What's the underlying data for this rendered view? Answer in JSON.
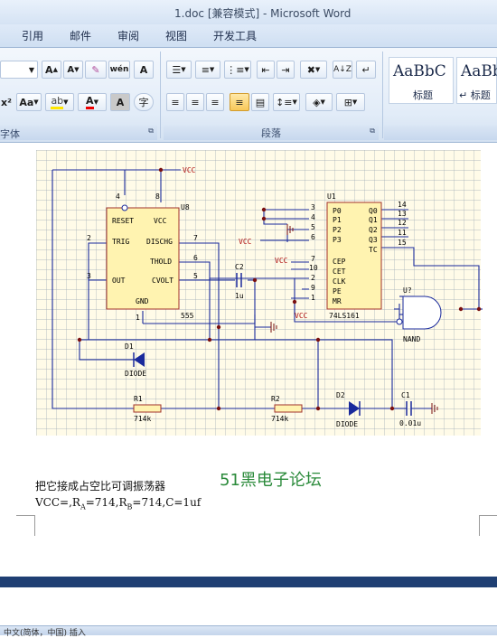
{
  "window": {
    "title": "1.doc [兼容模式] - Microsoft Word"
  },
  "tabs": [
    "引用",
    "邮件",
    "审阅",
    "视图",
    "开发工具"
  ],
  "ribbon": {
    "groups": {
      "font": "字体",
      "paragraph": "段落"
    },
    "styles": [
      {
        "sample": "AaBbC",
        "name": "标题"
      },
      {
        "sample": "AaBb",
        "name": "↵ 标题"
      }
    ]
  },
  "schematic": {
    "chips": {
      "timer_ref": "U8",
      "timer_name": "555",
      "counter_ref": "U1",
      "counter_name": "74LS161",
      "gate_ref": "U?",
      "gate_name": "NAND"
    },
    "timer_pins_left": [
      "RESET",
      "TRIG",
      "OUT"
    ],
    "timer_pins_right": [
      "VCC",
      "DISCHG",
      "THOLD",
      "CVOLT"
    ],
    "timer_pin_bottom": "GND",
    "timer_pin_numbers": [
      "4",
      "8",
      "2",
      "7",
      "6",
      "3",
      "5",
      "1"
    ],
    "counter_inputs": [
      "P0",
      "P1",
      "P2",
      "P3",
      "CEP",
      "CET",
      "CLK",
      "PE",
      "MR"
    ],
    "counter_input_numbers": [
      "3",
      "4",
      "5",
      "6",
      "7",
      "10",
      "2",
      "9",
      "1"
    ],
    "counter_outputs": [
      "Q0",
      "Q1",
      "Q2",
      "Q3",
      "TC"
    ],
    "counter_output_numbers": [
      "14",
      "13",
      "12",
      "11",
      "15"
    ],
    "parts": {
      "d1": "D1",
      "d1_type": "DIODE",
      "d2": "D2",
      "d2_type": "DIODE",
      "r1": "R1",
      "r1_val": "714k",
      "r2": "R2",
      "r2_val": "714k",
      "c1": "C1",
      "c1_val": "0.01u",
      "c2": "C2",
      "c2_val": "1u"
    },
    "vcc": "VCC"
  },
  "document": {
    "caption": "把它接成占空比可调振荡器",
    "params": "VCC=,RA=714,RB=714,C=1uf",
    "params_parts": {
      "a": "VCC=,R",
      "b": "A",
      "c": "=714,R",
      "d": "B",
      "e": "=714,C=1uf"
    },
    "watermark_num": "51",
    "watermark_text": "黑电子论坛"
  },
  "statusbar": {
    "text": "中文(简体，中国)    插入"
  }
}
